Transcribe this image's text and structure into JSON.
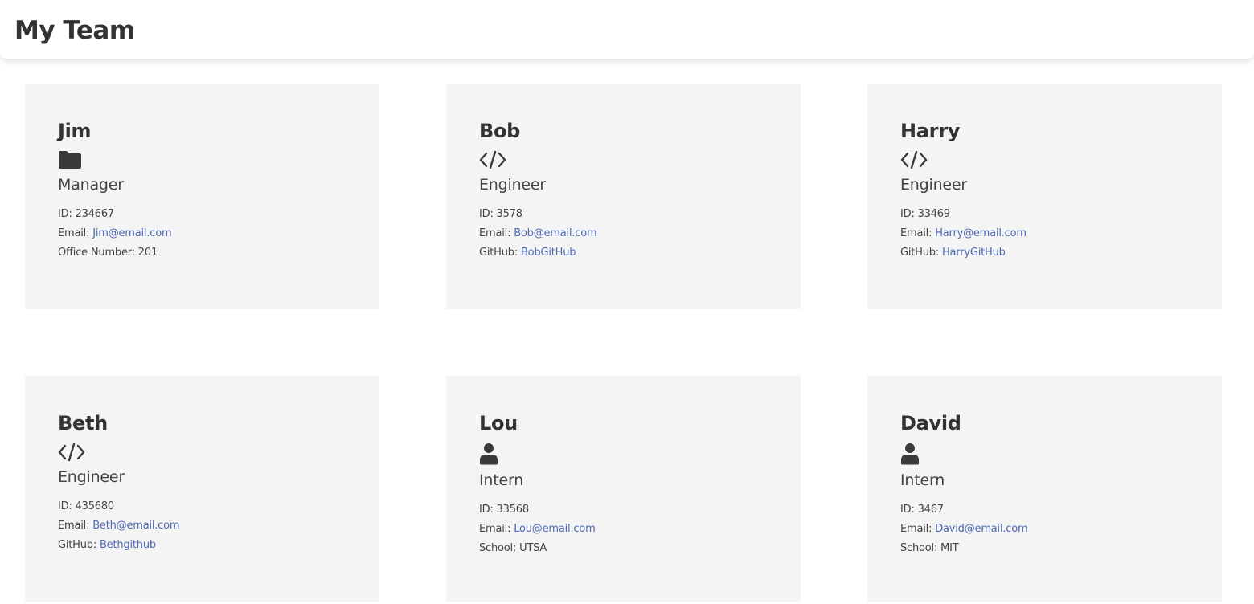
{
  "header": {
    "title": "My Team"
  },
  "team": [
    {
      "name": "Jim",
      "icon": "folder-icon",
      "role": "Manager",
      "id_label": "ID:",
      "id": "234667",
      "email_label": "Email:",
      "email": "Jim@email.com",
      "extra_label": "Office Number:",
      "extra": "201",
      "extra_is_link": false
    },
    {
      "name": "Bob",
      "icon": "code-icon",
      "role": "Engineer",
      "id_label": "ID:",
      "id": "3578",
      "email_label": "Email:",
      "email": "Bob@email.com",
      "extra_label": "GitHub:",
      "extra": "BobGitHub",
      "extra_is_link": true
    },
    {
      "name": "Harry",
      "icon": "code-icon",
      "role": "Engineer",
      "id_label": "ID:",
      "id": "33469",
      "email_label": "Email:",
      "email": "Harry@email.com",
      "extra_label": "GitHub:",
      "extra": "HarryGitHub",
      "extra_is_link": true
    },
    {
      "name": "Beth",
      "icon": "code-icon",
      "role": "Engineer",
      "id_label": "ID:",
      "id": "435680",
      "email_label": "Email:",
      "email": "Beth@email.com",
      "extra_label": "GitHub:",
      "extra": "Bethgithub",
      "extra_is_link": true
    },
    {
      "name": "Lou",
      "icon": "user-icon",
      "role": "Intern",
      "id_label": "ID:",
      "id": "33568",
      "email_label": "Email:",
      "email": "Lou@email.com",
      "extra_label": "School:",
      "extra": "UTSA",
      "extra_is_link": false
    },
    {
      "name": "David",
      "icon": "user-icon",
      "role": "Intern",
      "id_label": "ID:",
      "id": "3467",
      "email_label": "Email:",
      "email": "David@email.com",
      "extra_label": "School:",
      "extra": "MIT",
      "extra_is_link": false
    }
  ],
  "colors": {
    "card_background": "#f4f4f4",
    "link": "#4f69b5",
    "text": "#333333"
  }
}
